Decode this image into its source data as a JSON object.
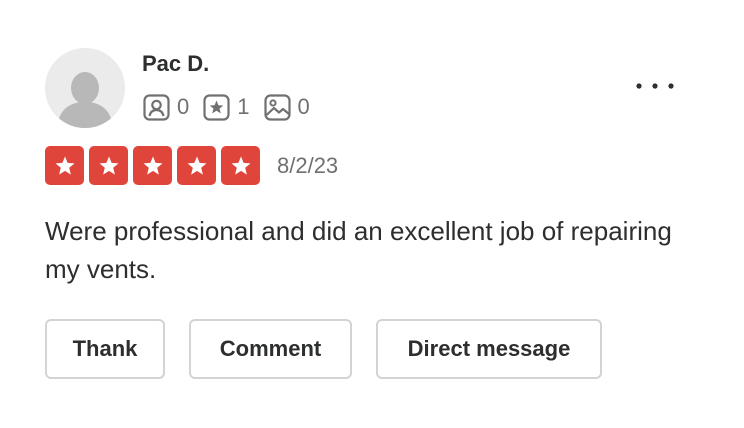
{
  "review": {
    "user_name": "Pac D.",
    "stats": {
      "friends": "0",
      "reviews": "1",
      "photos": "0"
    },
    "rating": 5,
    "date": "8/2/23",
    "text": "Were professional and did an excellent job of repairing my vents."
  },
  "actions": {
    "thank_label": "Thank",
    "comment_label": "Comment",
    "direct_message_label": "Direct message"
  },
  "icons": {
    "avatar": "default-avatar-icon",
    "friends": "friends-icon",
    "reviews": "review-star-icon",
    "photos": "photo-icon",
    "more": "more-options-icon",
    "star": "star-icon"
  },
  "colors": {
    "star_background": "#e0453c",
    "text_primary": "#2d2e2f",
    "text_secondary": "#6e7072",
    "button_border": "#d3d3d3"
  }
}
